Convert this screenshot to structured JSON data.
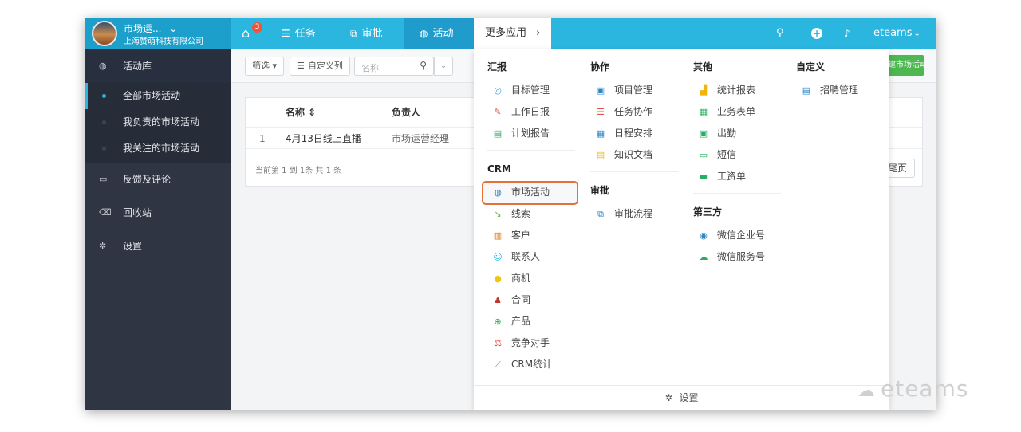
{
  "header": {
    "brand_name": "市场运...",
    "brand_caret": "⌄",
    "brand_org": "上海赞萌科技有限公司",
    "home_badge": "3",
    "nav": {
      "tasks": "任务",
      "approval": "审批",
      "activity": "活动",
      "more": "更多应用",
      "more_arrow": "›"
    },
    "user": "eteams",
    "user_caret": "⌄"
  },
  "sidebar": {
    "items": [
      {
        "label": "活动库"
      },
      {
        "label": "反馈及评论"
      },
      {
        "label": "回收站"
      },
      {
        "label": "设置"
      }
    ],
    "subitems": [
      {
        "label": "全部市场活动"
      },
      {
        "label": "我负责的市场活动"
      },
      {
        "label": "我关注的市场活动"
      }
    ]
  },
  "toolbar": {
    "filter": "筛选 ▾",
    "custom_columns": "自定义列",
    "search_placeholder": "名称",
    "new_activity": "新建市场活动"
  },
  "table": {
    "headers": [
      "名称 ⇕",
      "负责人"
    ],
    "rows": [
      {
        "index": "1",
        "name": "4月13日线上直播",
        "owner": "市场运营经理"
      }
    ],
    "pager_info": "当前第 1 到 1条 共 1 条",
    "last_page": "尾页"
  },
  "dropdown": {
    "groups": {
      "report": {
        "title": "汇报",
        "items": [
          "目标管理",
          "工作日报",
          "计划报告"
        ]
      },
      "crm": {
        "title": "CRM",
        "items": [
          "市场活动",
          "线索",
          "客户",
          "联系人",
          "商机",
          "合同",
          "产品",
          "竞争对手",
          "CRM统计"
        ]
      },
      "collab": {
        "title": "协作",
        "items": [
          "项目管理",
          "任务协作",
          "日程安排",
          "知识文档"
        ]
      },
      "approval": {
        "title": "审批",
        "items": [
          "审批流程"
        ]
      },
      "other": {
        "title": "其他",
        "items": [
          "统计报表",
          "业务表单",
          "出勤",
          "短信",
          "工资单"
        ]
      },
      "thirdparty": {
        "title": "第三方",
        "items": [
          "微信企业号",
          "微信服务号"
        ]
      },
      "custom": {
        "title": "自定义",
        "items": [
          "招聘管理"
        ]
      }
    },
    "footer": "设置"
  },
  "watermark": "eteams",
  "colors": {
    "topbar": "#2bb6e0",
    "sidebar": "#2f3542",
    "highlight_border": "#e4713c",
    "green_button": "#4cb84f"
  }
}
